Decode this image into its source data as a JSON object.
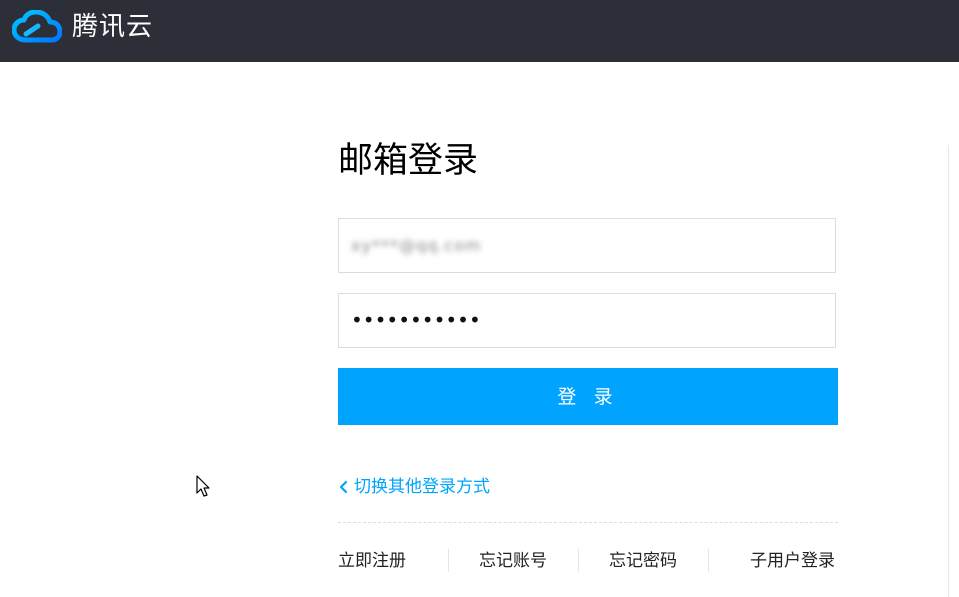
{
  "header": {
    "brand_name": "腾讯云",
    "logo_icon": "cloud-logo-icon",
    "background": "#2c2e38"
  },
  "login": {
    "title": "邮箱登录",
    "email_value": "xy***@qq.com",
    "password_value": "•••••••••••",
    "submit_label": "登 录",
    "switch_label": "切换其他登录方式",
    "accent": "#00a4ff"
  },
  "footer_links": {
    "register": "立即注册",
    "forgot_account": "忘记账号",
    "forgot_password": "忘记密码",
    "sub_user_login": "子用户登录"
  }
}
